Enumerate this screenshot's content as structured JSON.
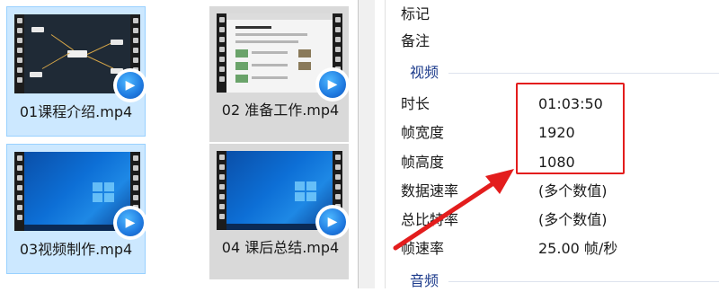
{
  "files": [
    {
      "name": "01课程介绍.mp4",
      "thumbnail": "mindmap",
      "state": "selected"
    },
    {
      "name": "02 准备工作.mp4",
      "thumbnail": "webpage",
      "state": "gray"
    },
    {
      "name": "03视频制作.mp4",
      "thumbnail": "windows-desktop",
      "state": "selected"
    },
    {
      "name": "04 课后总结.mp4",
      "thumbnail": "windows-desktop",
      "state": "gray"
    }
  ],
  "properties": {
    "top_rows": [
      {
        "label": "标记",
        "value": ""
      },
      {
        "label": "备注",
        "value": ""
      }
    ],
    "video_section": {
      "title": "视频",
      "rows": [
        {
          "label": "时长",
          "value": "01:03:50"
        },
        {
          "label": "帧宽度",
          "value": "1920"
        },
        {
          "label": "帧高度",
          "value": "1080"
        },
        {
          "label": "数据速率",
          "value": "(多个数值)"
        },
        {
          "label": "总比特率",
          "value": "(多个数值)"
        },
        {
          "label": "帧速率",
          "value": "25.00 帧/秒"
        }
      ]
    },
    "audio_section": {
      "title": "音频"
    }
  },
  "icons": {
    "play_badge": "video-player-icon"
  },
  "colors": {
    "selected_bg": "#cce8ff",
    "gray_bg": "#d9d9d9",
    "section_text": "#1e3c8c",
    "annotation_red": "#e31d1d"
  }
}
